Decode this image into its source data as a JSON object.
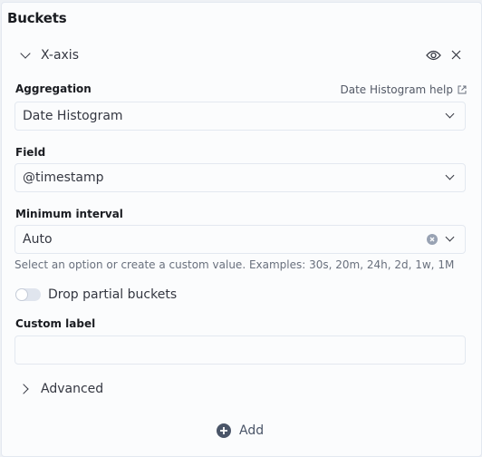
{
  "panel": {
    "title": "Buckets"
  },
  "bucket": {
    "name": "X-axis",
    "toggle_icon": "eye-icon",
    "remove_icon": "close-icon",
    "aggregation": {
      "label": "Aggregation",
      "help_link": "Date Histogram help",
      "value": "Date Histogram"
    },
    "field": {
      "label": "Field",
      "value": "@timestamp"
    },
    "interval": {
      "label": "Minimum interval",
      "value": "Auto",
      "help": "Select an option or create a custom value. Examples: 30s, 20m, 24h, 2d, 1w, 1M"
    },
    "drop_partial": {
      "label": "Drop partial buckets",
      "checked": false
    },
    "custom_label": {
      "label": "Custom label",
      "value": ""
    },
    "advanced": "Advanced"
  },
  "add_button": "Add"
}
